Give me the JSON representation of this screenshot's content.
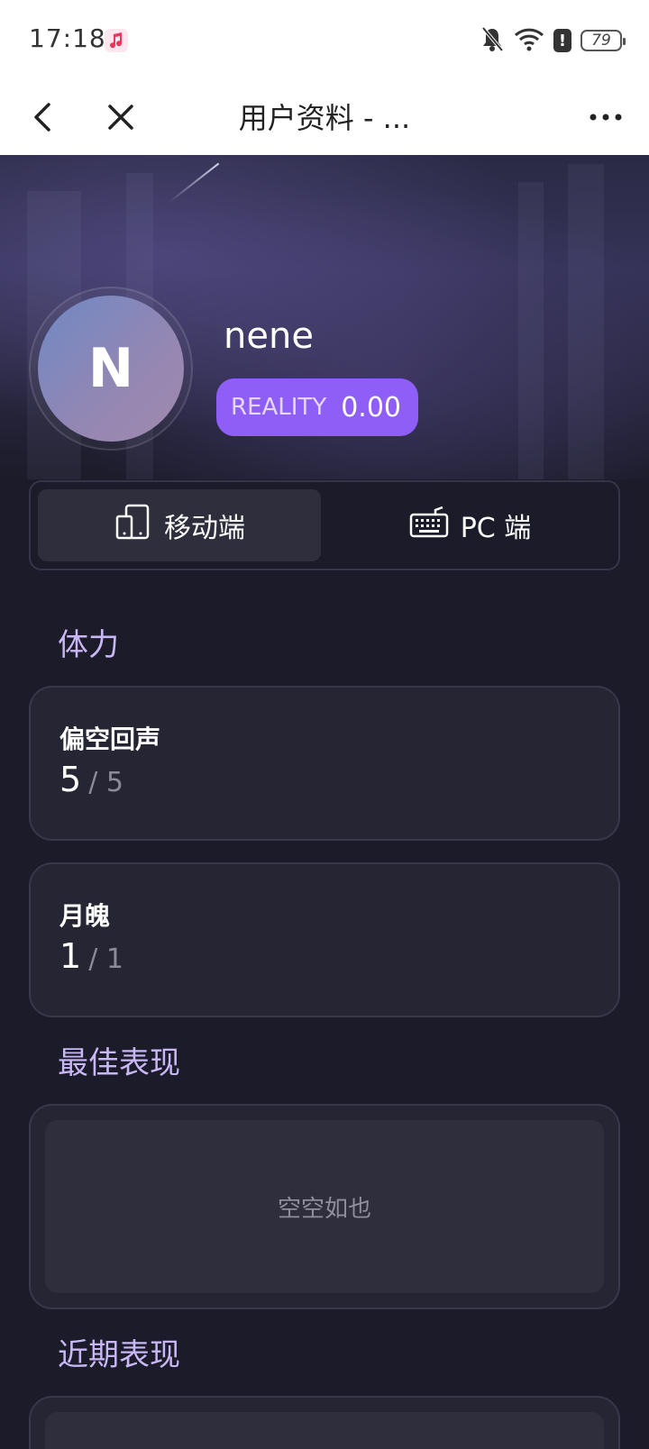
{
  "status_bar": {
    "time": "17:18",
    "battery": "79",
    "alert": "!"
  },
  "nav": {
    "title": "用户资料 - ..."
  },
  "profile": {
    "avatar_letter": "N",
    "username": "nene",
    "reality_label": "REALITY",
    "reality_value": "0.00"
  },
  "platform_tabs": [
    {
      "label": "移动端",
      "icon": "mobile-device-icon",
      "selected": true
    },
    {
      "label": "PC 端",
      "icon": "keyboard-icon",
      "selected": false
    }
  ],
  "stamina": {
    "title": "体力",
    "items": [
      {
        "name": "偏空回声",
        "current": "5",
        "max": "/ 5"
      },
      {
        "name": "月魄",
        "current": "1",
        "max": "/ 1"
      }
    ]
  },
  "best": {
    "title": "最佳表现",
    "empty_text": "空空如也"
  },
  "recent": {
    "title": "近期表现"
  },
  "colors": {
    "accent": "#8f5ef6",
    "section_title": "#c9b7f5",
    "background": "#1b1b29",
    "card": "#252533"
  }
}
